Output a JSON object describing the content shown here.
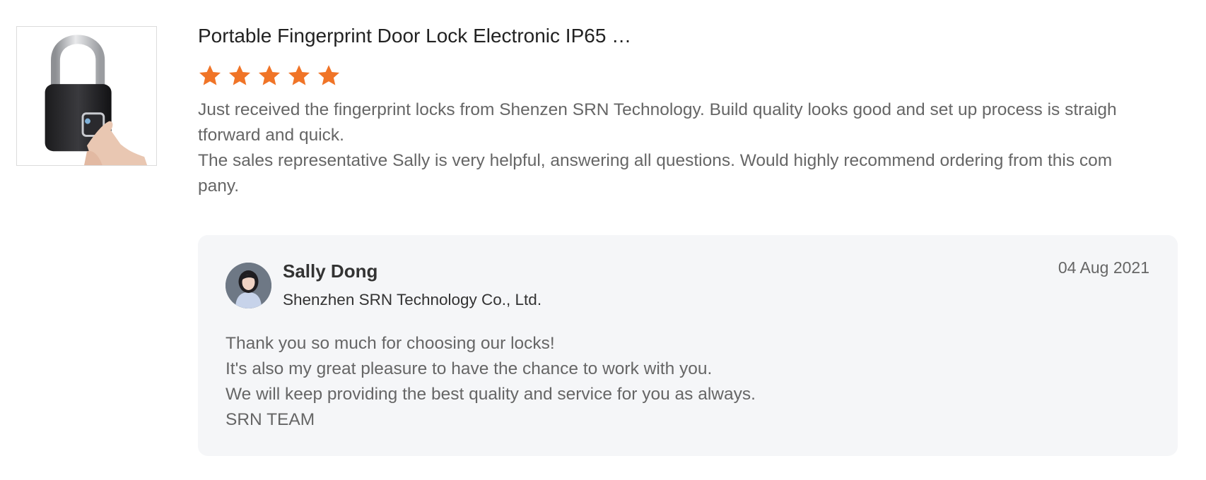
{
  "review": {
    "product_image_icon": "padlock-fingerprint-image",
    "product_title": "Portable Fingerprint Door Lock Electronic IP65 …",
    "rating": 5,
    "rating_max": 5,
    "star_color": "#f07427",
    "text_lines": [
      "Just received the fingerprint locks from Shenzen SRN Technology.  Build quality looks good and set up process is straightforward and quick.",
      "The sales representative Sally is very helpful, answering all questions. Would highly recommend ordering from this company."
    ]
  },
  "reply": {
    "avatar_icon": "seller-avatar",
    "seller_name": "Sally Dong",
    "company": "Shenzhen SRN Technology Co., Ltd.",
    "date": "04 Aug 2021",
    "lines": [
      "Thank you so much for choosing our locks!",
      "It's also my great pleasure to have the chance to work with you.",
      "We will keep providing the best quality and service for you as always.",
      "SRN TEAM"
    ],
    "background_color": "#f5f6f8"
  }
}
